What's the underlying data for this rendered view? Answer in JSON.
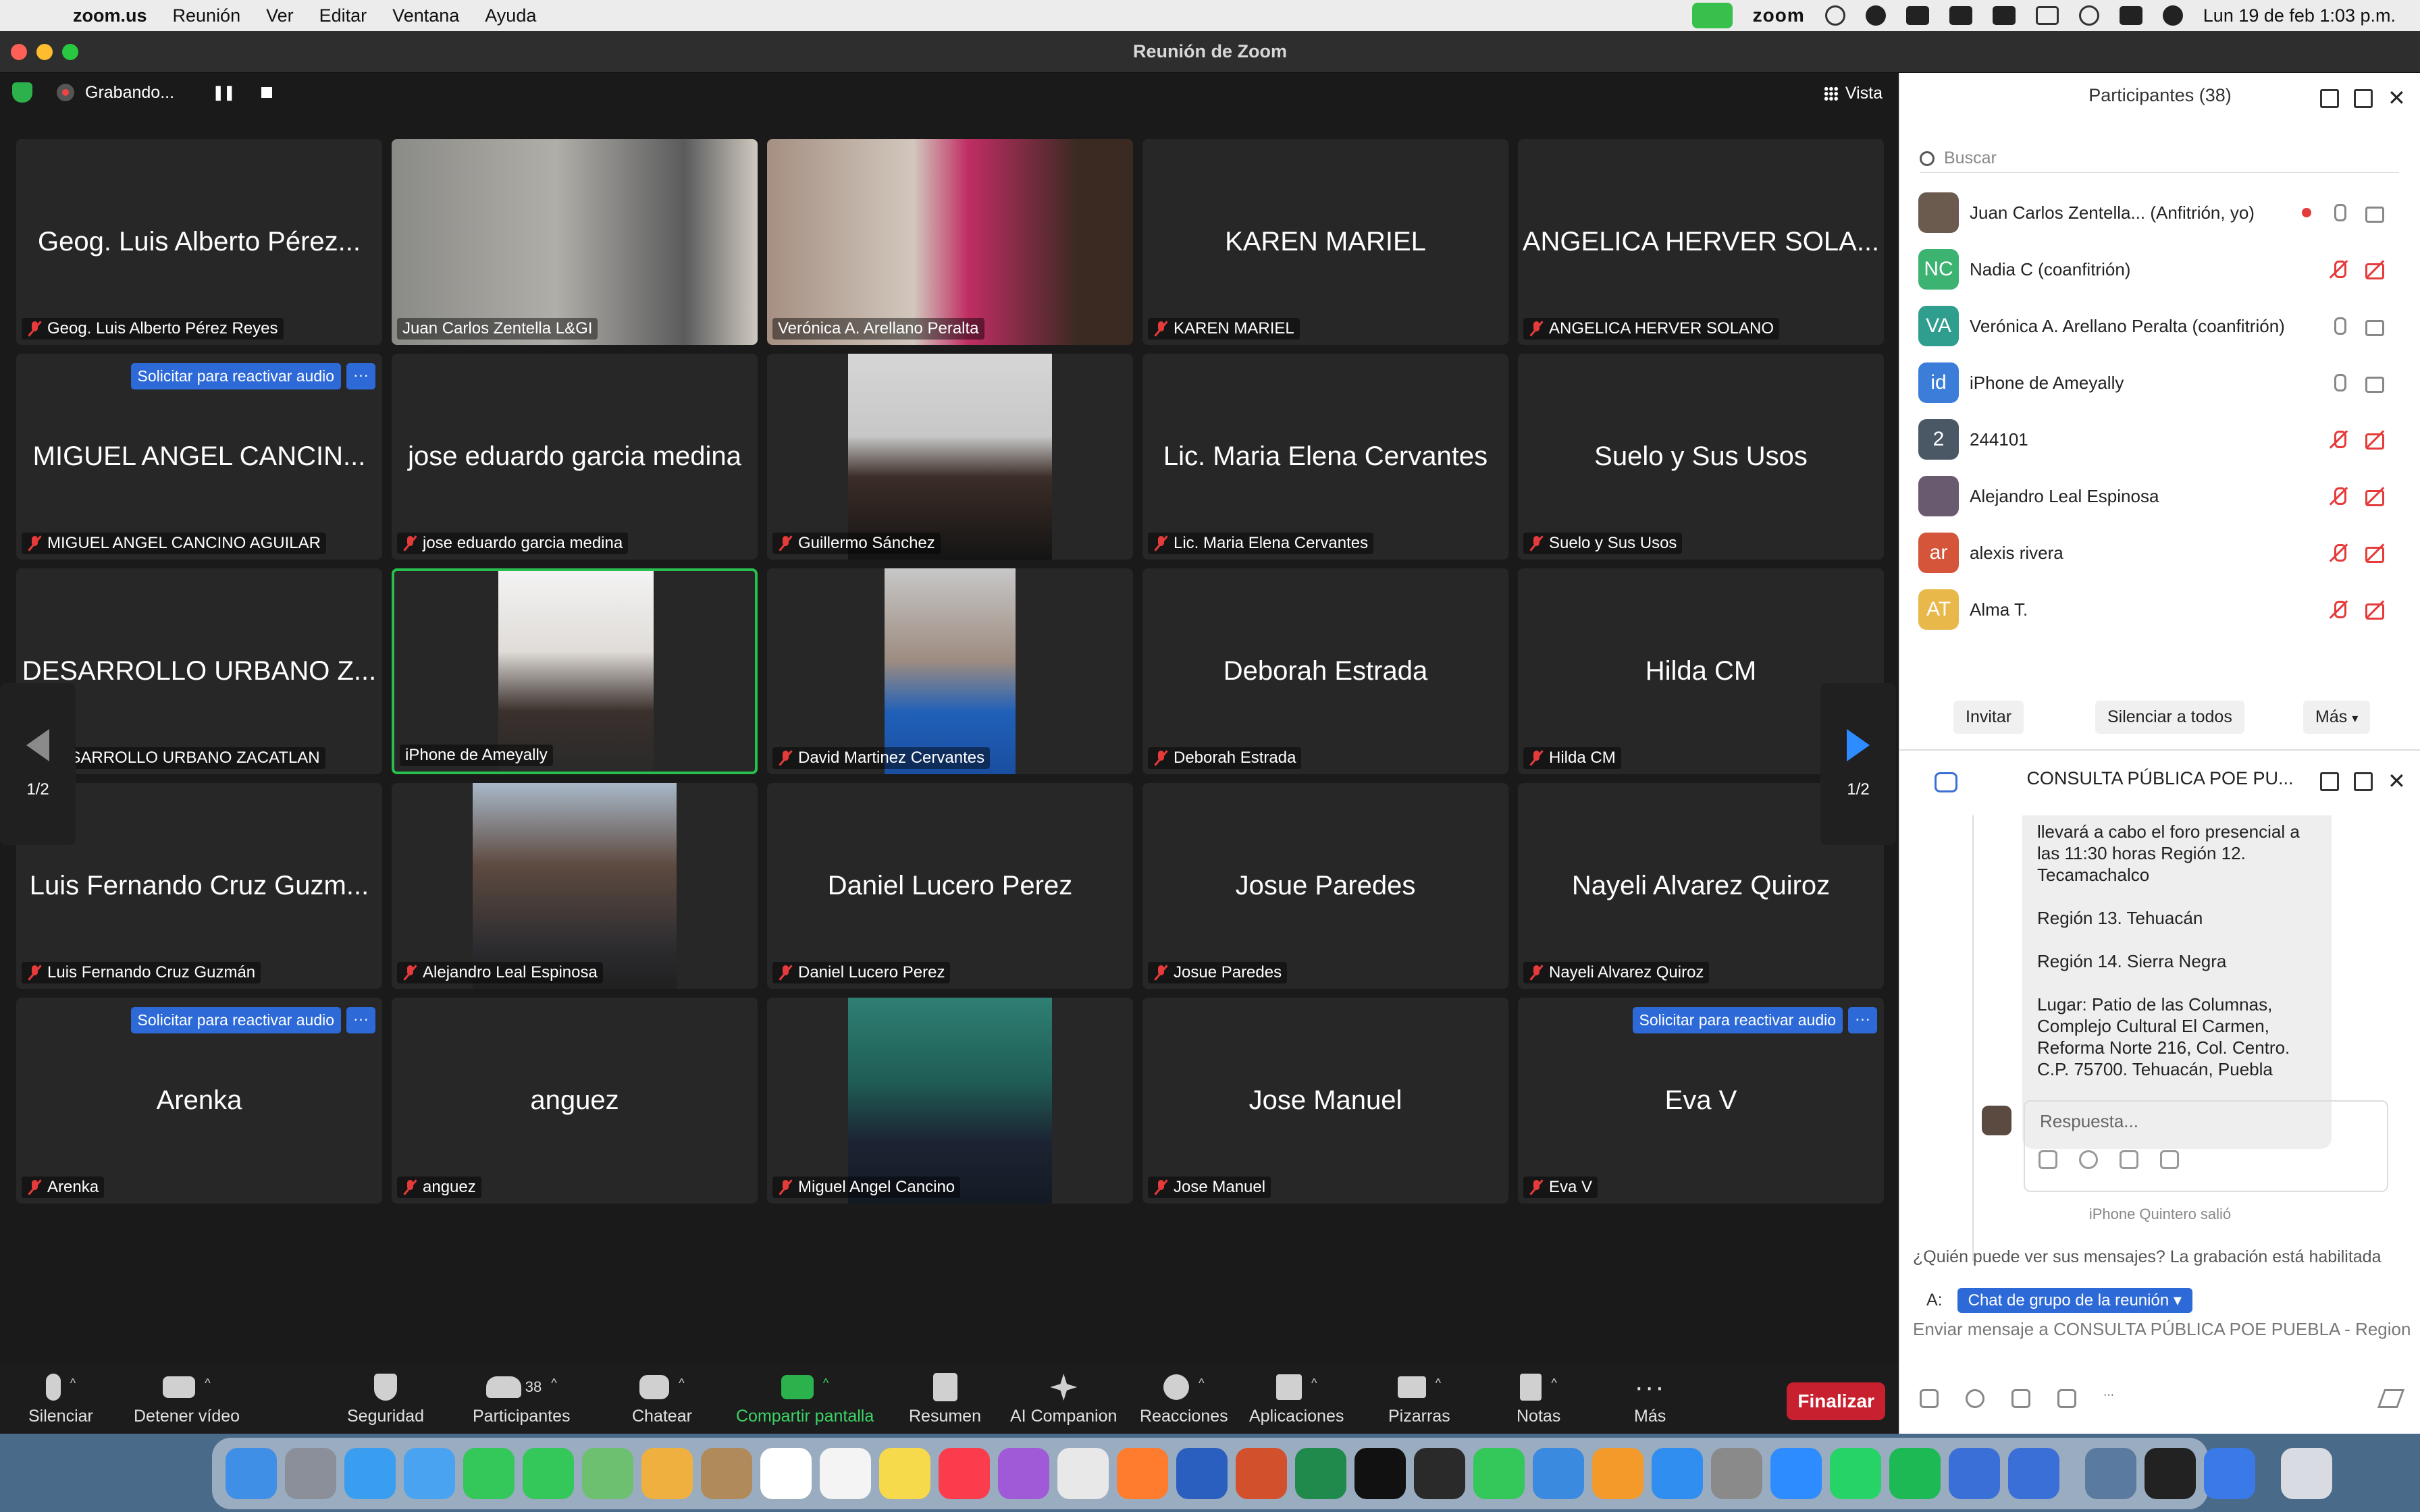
{
  "menubar": {
    "app_name": "zoom.us",
    "items": [
      "Reunión",
      "Ver",
      "Editar",
      "Ventana",
      "Ayuda"
    ],
    "right_app": "zoom",
    "datetime": "Lun 19 de feb  1:03 p.m."
  },
  "window": {
    "title": "Reunión de Zoom"
  },
  "recording": {
    "label": "Grabando...",
    "pause": "❚❚"
  },
  "view_button": "Vista",
  "pager": {
    "left": "1/2",
    "right": "1/2"
  },
  "tiles": [
    {
      "big": "Geog. Luis Alberto Pérez...",
      "label": "Geog. Luis Alberto Pérez Reyes",
      "muted": true
    },
    {
      "big": "",
      "label": "Juan Carlos Zentella L&GI",
      "muted": false
    },
    {
      "big": "",
      "label": "Verónica A. Arellano Peralta",
      "muted": false
    },
    {
      "big": "KAREN MARIEL",
      "label": "KAREN MARIEL",
      "muted": true
    },
    {
      "big": "ANGELICA HERVER SOLA...",
      "label": "ANGELICA HERVER SOLANO",
      "muted": true
    },
    {
      "big": "MIGUEL ANGEL CANCIN...",
      "label": "MIGUEL ANGEL CANCINO AGUILAR",
      "muted": true,
      "request": true
    },
    {
      "big": "jose eduardo garcia medina",
      "label": "jose eduardo garcia medina",
      "muted": true
    },
    {
      "big": "",
      "label": "Guillermo Sánchez",
      "muted": true
    },
    {
      "big": "Lic. Maria Elena Cervantes",
      "label": "Lic. Maria Elena Cervantes",
      "muted": true
    },
    {
      "big": "Suelo y Sus Usos",
      "label": "Suelo y Sus Usos",
      "muted": true
    },
    {
      "big": "DESARROLLO URBANO Z...",
      "label": "DESARROLLO URBANO ZACATLAN",
      "muted": true
    },
    {
      "big": "",
      "label": "iPhone de Ameyally",
      "muted": false
    },
    {
      "big": "",
      "label": "David Martinez Cervantes",
      "muted": true
    },
    {
      "big": "Deborah Estrada",
      "label": "Deborah Estrada",
      "muted": true
    },
    {
      "big": "Hilda CM",
      "label": "Hilda CM",
      "muted": true
    },
    {
      "big": "Luis Fernando Cruz Guzm...",
      "label": "Luis Fernando Cruz Guzmán",
      "muted": true
    },
    {
      "big": "",
      "label": "Alejandro Leal Espinosa",
      "muted": true
    },
    {
      "big": "Daniel Lucero Perez",
      "label": "Daniel Lucero Perez",
      "muted": true
    },
    {
      "big": "Josue Paredes",
      "label": "Josue Paredes",
      "muted": true
    },
    {
      "big": "Nayeli Alvarez Quiroz",
      "label": "Nayeli Alvarez Quiroz",
      "muted": true
    },
    {
      "big": "Arenka",
      "label": "Arenka",
      "muted": true,
      "request": true
    },
    {
      "big": "anguez",
      "label": "anguez",
      "muted": true
    },
    {
      "big": "",
      "label": "Miguel Angel Cancino",
      "muted": true
    },
    {
      "big": "Jose Manuel",
      "label": "Jose Manuel",
      "muted": true
    },
    {
      "big": "Eva V",
      "label": "Eva V",
      "muted": true,
      "request": true
    }
  ],
  "request_audio_label": "Solicitar para reactivar audio",
  "request_more": "···",
  "toolbar": {
    "items": [
      "Silenciar",
      "Detener vídeo",
      "Seguridad",
      "Participantes",
      "Chatear",
      "Compartir pantalla",
      "Resumen",
      "AI Companion",
      "Reacciones",
      "Aplicaciones",
      "Pizarras",
      "Notas",
      "Más"
    ],
    "participants_count": "38",
    "end": "Finalizar"
  },
  "participants_panel": {
    "title": "Participantes (38)",
    "search_placeholder": "Buscar",
    "list": [
      {
        "initials": "",
        "name": "Juan Carlos Zentella...  (Anfitrión, yo)",
        "color": "#6b5a4e",
        "muted": false
      },
      {
        "initials": "NC",
        "name": "Nadia C (coanfitrión)",
        "color": "#3cb371",
        "muted": true
      },
      {
        "initials": "VA",
        "name": "Verónica A. Arellano Peralta (coanfitrión)",
        "color": "#2f9e8f",
        "muted": false
      },
      {
        "initials": "id",
        "name": "iPhone de Ameyally",
        "color": "#3b7dd8",
        "muted": false
      },
      {
        "initials": "2",
        "name": "244101",
        "color": "#4a5866",
        "muted": true
      },
      {
        "initials": "",
        "name": "Alejandro Leal Espinosa",
        "color": "#6a5a70",
        "muted": true
      },
      {
        "initials": "ar",
        "name": "alexis rivera",
        "color": "#d4553a",
        "muted": true
      },
      {
        "initials": "AT",
        "name": "Alma T.",
        "color": "#e8b84a",
        "muted": true
      }
    ],
    "invite": "Invitar",
    "mute_all": "Silenciar a todos",
    "more": "Más"
  },
  "chat_panel": {
    "title": "CONSULTA PÚBLICA POE PU...",
    "message": "llevará a cabo el foro presencial a las 11:30 horas Región 12. Tecamachalco\n\nRegión 13. Tehuacán\n\nRegión 14. Sierra Negra\n\nLugar: Patio de las Columnas, Complejo Cultural El Carmen, Reforma Norte 216, Col. Centro. C.P. 75700. Tehuacán, Puebla",
    "reply_placeholder": "Respuesta...",
    "system_note": "iPhone Quintero salió",
    "who_can_see": "¿Quién puede ver sus mensajes? La grabación está habilitada",
    "to_label": "A:",
    "to_target": "Chat de grupo de la reunión",
    "input_placeholder": "Enviar mensaje a CONSULTA PÚBLICA POE PUEBLA - Region..."
  }
}
